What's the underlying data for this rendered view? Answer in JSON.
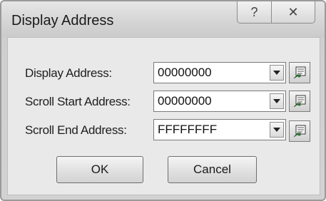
{
  "window": {
    "title": "Display Address",
    "help_glyph": "?",
    "close_glyph": "✕"
  },
  "fields": [
    {
      "label": "Display Address:",
      "value": "00000000",
      "icon": "chevron-down-icon",
      "pick_icon": "select-address-icon"
    },
    {
      "label": "Scroll Start Address:",
      "value": "00000000",
      "icon": "chevron-down-icon",
      "pick_icon": "select-address-icon"
    },
    {
      "label": "Scroll End Address:",
      "value": "FFFFFFFF",
      "icon": "chevron-down-icon",
      "pick_icon": "select-address-icon"
    }
  ],
  "buttons": {
    "ok_label": "OK",
    "cancel_label": "Cancel"
  }
}
